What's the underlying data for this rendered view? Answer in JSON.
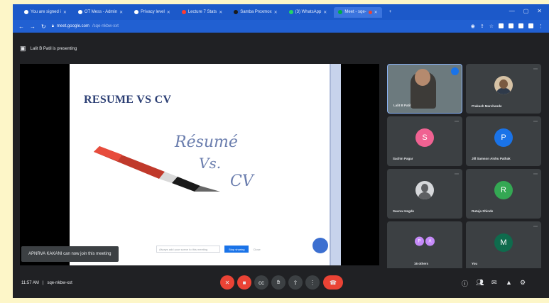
{
  "browser": {
    "tabs": [
      {
        "label": "You are signed i",
        "active": false
      },
      {
        "label": "OT Mess - Admin",
        "active": false
      },
      {
        "label": "Privacy level",
        "active": false
      },
      {
        "label": "Lecture 7 Stats",
        "active": false
      },
      {
        "label": "Samba Proxmox",
        "active": false
      },
      {
        "label": "(3) WhatsApp",
        "active": false
      },
      {
        "label": "Meet - sqe-",
        "active": true
      }
    ],
    "new_tab": "+",
    "url_host": "meet.google.com",
    "url_path": "/sqe-nkbw-xxt"
  },
  "meet": {
    "presenting_label": "Lalit B Patil is presenting",
    "toast": "APNRVA KAKANI can now join this meeting",
    "time": "11:57 AM",
    "code": "sqe-nkbw-xxt"
  },
  "slide": {
    "title": "RESUME VS CV",
    "word1": "Résumé",
    "word2": "Vs.",
    "word3": "CV",
    "share_text": "Always add your scene to this meeting",
    "share_button": "Stop sharing",
    "dismiss": "Close"
  },
  "participants": [
    {
      "name": "Lalit B Patil",
      "type": "video"
    },
    {
      "name": "Prakash Marchande",
      "type": "photo"
    },
    {
      "name": "Sachin Pagar",
      "initial": "S",
      "color": "#f06292"
    },
    {
      "name": "Jill Samson Aishu Pathak",
      "initial": "P",
      "color": "#1a73e8"
    },
    {
      "name": "Saurav Hegde",
      "type": "generic"
    },
    {
      "name": "Rutuja Shinde",
      "initial": "R",
      "color": "#34a853"
    },
    {
      "name": "16 others",
      "initials": [
        "P",
        "A"
      ],
      "color": "#c58af9"
    },
    {
      "name": "You",
      "initial": "M",
      "color": "#0f6b4d"
    }
  ],
  "icons": {
    "present": "present-icon",
    "mic_off": "mic-off-icon",
    "cam_off": "cam-off-icon",
    "captions": "captions-icon",
    "raise_hand": "raise-hand-icon",
    "present_now": "present-now-icon",
    "more": "more-icon",
    "end_call": "end-call-icon",
    "info": "info-icon",
    "people": "people-icon",
    "chat": "chat-icon",
    "activities": "activities-icon",
    "host_controls": "host-controls-icon"
  }
}
